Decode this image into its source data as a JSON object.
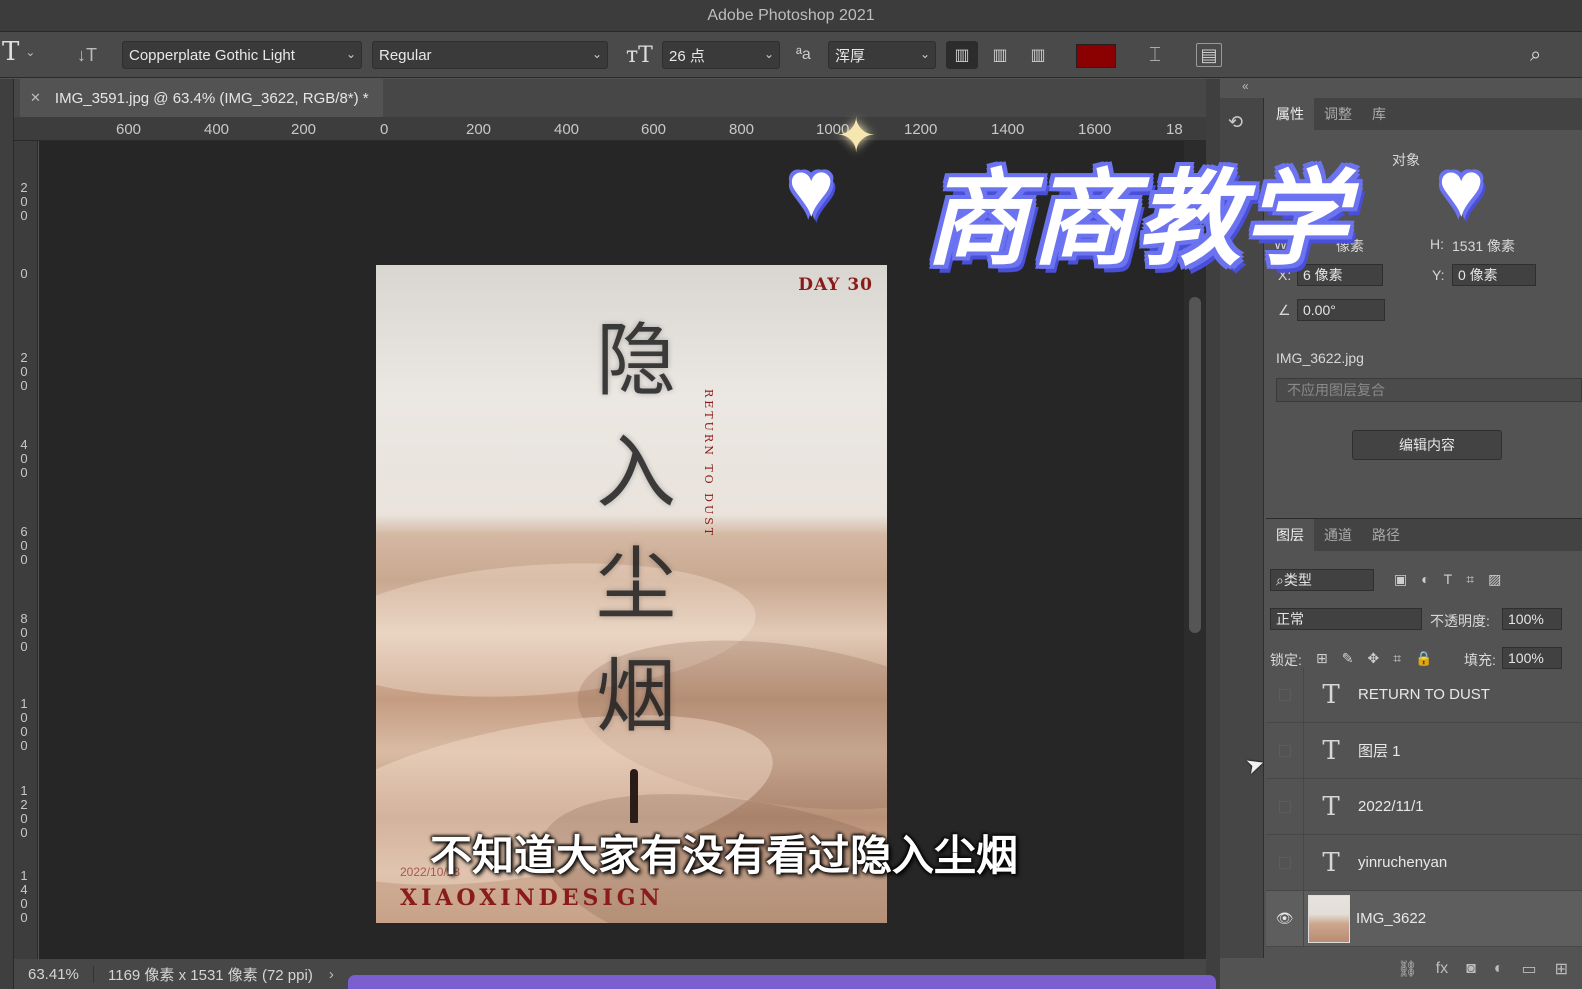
{
  "app": {
    "title": "Adobe Photoshop 2021"
  },
  "options_bar": {
    "tool_glyph": "T",
    "font_family": "Copperplate Gothic Light",
    "font_style": "Regular",
    "font_size": "26 点",
    "antialias": "浑厚",
    "text_color": "#8b0000"
  },
  "document": {
    "tab_title": "IMG_3591.jpg @ 63.4% (IMG_3622, RGB/8*) *",
    "ruler_top": [
      "600",
      "400",
      "200",
      "0",
      "200",
      "400",
      "600",
      "800",
      "1000",
      "1200",
      "1400",
      "1600",
      "18"
    ],
    "ruler_left": [
      "200",
      "0",
      "200",
      "400",
      "600",
      "800",
      "1000",
      "1200",
      "1400"
    ]
  },
  "poster": {
    "day": "DAY 30",
    "poem": [
      "隐",
      "入",
      "尘",
      "烟"
    ],
    "subtitle_en": "RETURN TO DUST",
    "date": "2022/10/28",
    "brand": "XIAOXINDESIGN"
  },
  "overlay": {
    "subtitle": "不知道大家有没有看过隐入尘烟",
    "watermark": "商商教学"
  },
  "properties": {
    "tabs": [
      "属性",
      "调整",
      "库"
    ],
    "object_type": "对象",
    "w_label": "W:",
    "w_value": "像素",
    "h_label": "H:",
    "h_value": "1531 像素",
    "x_label": "X:",
    "x_value": "6 像素",
    "y_label": "Y:",
    "y_value": "0 像素",
    "angle": "0.00°",
    "file_name": "IMG_3622.jpg",
    "layer_comp": "不应用图层复合",
    "edit_button": "编辑内容"
  },
  "layers": {
    "tabs": [
      "图层",
      "通道",
      "路径"
    ],
    "filter": "类型",
    "blend_mode": "正常",
    "opacity_label": "不透明度:",
    "opacity": "100%",
    "lock_label": "锁定:",
    "fill_label": "填充:",
    "fill": "100%",
    "items": [
      {
        "name": "RETURN TO DUST",
        "type": "text",
        "visible": false
      },
      {
        "name": "图层 1",
        "type": "text",
        "visible": false
      },
      {
        "name": "2022/11/1",
        "type": "text",
        "visible": false
      },
      {
        "name": "yinruchenyan",
        "type": "text",
        "visible": false
      },
      {
        "name": "IMG_3622",
        "type": "image",
        "visible": true
      }
    ]
  },
  "status": {
    "zoom": "63.41%",
    "dims": "1169 像素 x 1531 像素 (72 ppi)",
    "more": "›"
  }
}
